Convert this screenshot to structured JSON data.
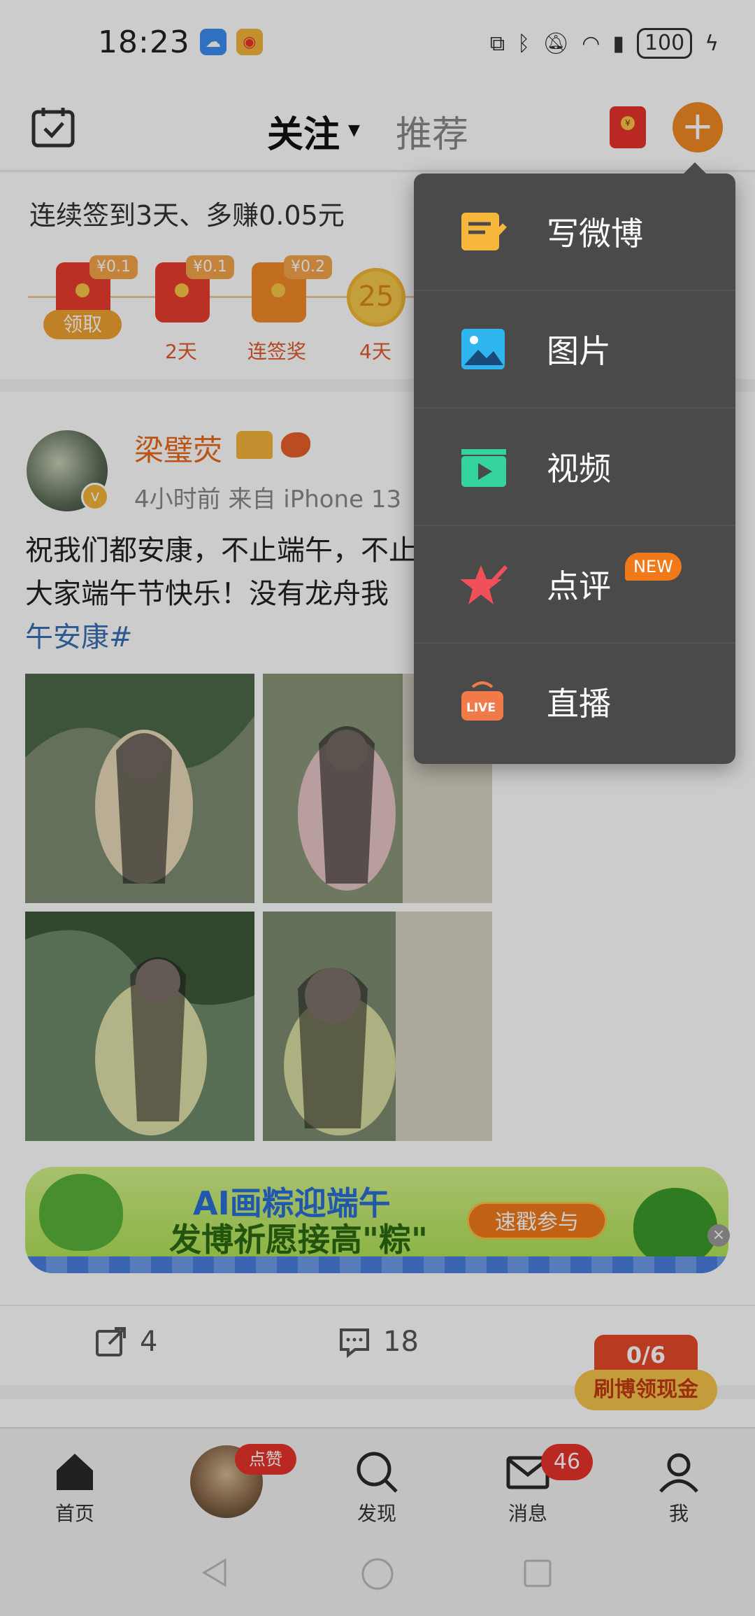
{
  "status_bar": {
    "time": "18:23",
    "battery": "100"
  },
  "header": {
    "tab_follow": "关注",
    "tab_recommend": "推荐"
  },
  "signin": {
    "title": "连续签到3天、多赚0.05元",
    "items": [
      {
        "tag": "¥0.1",
        "label": "领取"
      },
      {
        "tag": "¥0.1",
        "label": "2天"
      },
      {
        "tag": "¥0.2",
        "label": "连签奖"
      },
      {
        "coin": "25",
        "label": "4天"
      }
    ]
  },
  "post": {
    "username": "梁璧荧",
    "meta": "4小时前   来自 iPhone 13",
    "text_line1": "祝我们都安康，不止端午，不止此时",
    "text_line2": "大家端午节快乐！没有龙舟我",
    "topic": "午安康#",
    "banner": {
      "line1": "AI画粽迎端午",
      "line2": "发博祈愿接高\"粽\"",
      "button": "速戳参与"
    },
    "actions": {
      "repost": "4",
      "comment": "18"
    }
  },
  "cash_widget": {
    "progress": "0/6",
    "label": "刷博领现金"
  },
  "menu": {
    "items": [
      {
        "label": "写微博",
        "icon": "compose-icon"
      },
      {
        "label": "图片",
        "icon": "image-icon"
      },
      {
        "label": "视频",
        "icon": "video-icon"
      },
      {
        "label": "点评",
        "icon": "review-star-icon",
        "badge": "NEW"
      },
      {
        "label": "直播",
        "icon": "live-icon"
      }
    ]
  },
  "bottom_nav": {
    "home": "首页",
    "like_badge": "点赞",
    "discover": "发现",
    "messages": "消息",
    "messages_badge": "46",
    "me": "我"
  },
  "colors": {
    "accent_orange": "#f08a24",
    "menu_bg": "#4a4a4a",
    "link_blue": "#3a6fb5"
  }
}
